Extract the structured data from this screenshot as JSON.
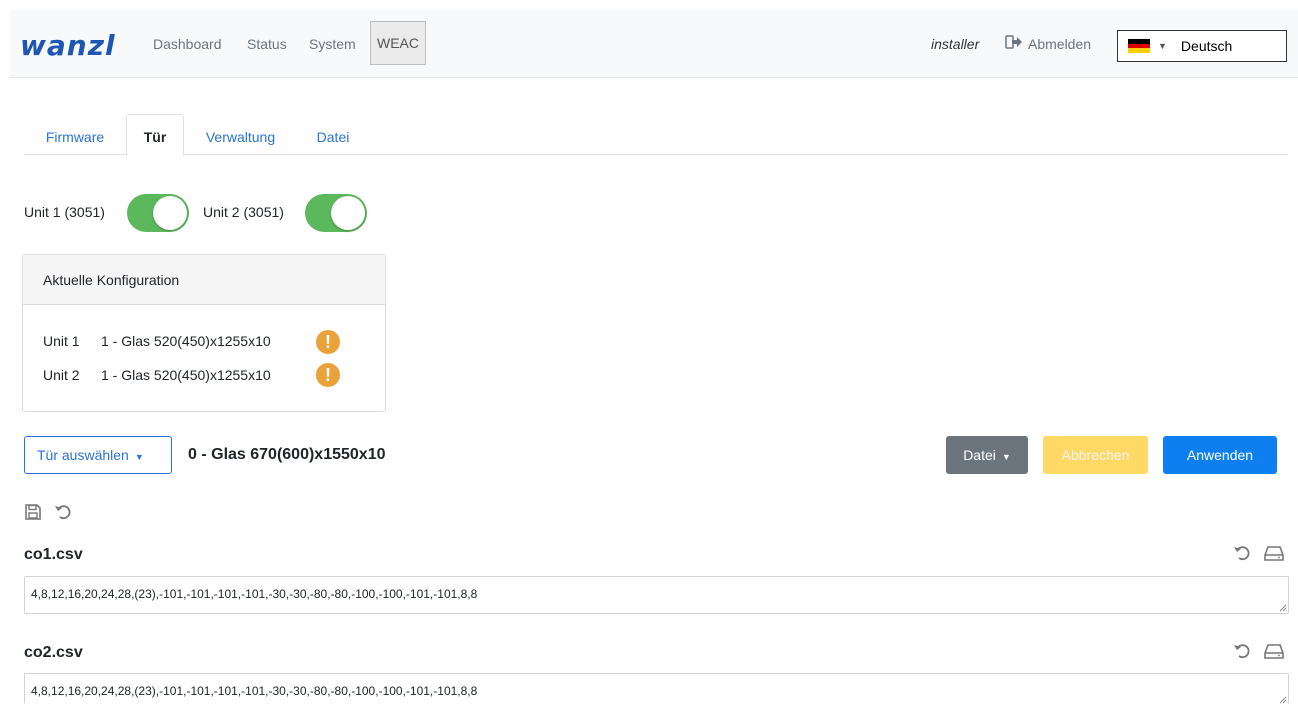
{
  "navbar": {
    "brand": "wanzl",
    "links": [
      "Dashboard",
      "Status",
      "System",
      "WEAC"
    ],
    "user": "installer",
    "logout_label": "Abmelden",
    "language": "Deutsch",
    "icons": {
      "logout": "sign-out-icon",
      "flag": "german-flag-icon"
    }
  },
  "tabs": [
    "Firmware",
    "Tür",
    "Verwaltung",
    "Datei"
  ],
  "units": {
    "unit1_label": "Unit 1 (3051)",
    "unit1_on": true,
    "unit2_label": "Unit 2 (3051)",
    "unit2_on": true
  },
  "config_card": {
    "title": "Aktuelle Konfiguration",
    "rows": [
      {
        "unit": "Unit 1",
        "value": "1 - Glas 520(450)x1255x10",
        "warning": "!"
      },
      {
        "unit": "Unit 2",
        "value": "1 - Glas 520(450)x1255x10",
        "warning": "!"
      }
    ]
  },
  "door": {
    "select_label": "Tür auswählen",
    "selected": "0 - Glas 670(600)x1550x10"
  },
  "actions": {
    "file_label": "Datei",
    "cancel_label": "Abbrechen",
    "apply_label": "Anwenden"
  },
  "files": [
    {
      "name": "co1.csv",
      "content": "4,8,12,16,20,24,28,(23),-101,-101,-101,-101,-30,-30,-80,-80,-100,-100,-101,-101,8,8"
    },
    {
      "name": "co2.csv",
      "content": "4,8,12,16,20,24,28,(23),-101,-101,-101,-101,-30,-30,-80,-80,-100,-100,-101,-101,8,8"
    }
  ],
  "colors": {
    "brand": "#1e56b4",
    "toggle_on": "#5cb85c",
    "warning": "#eaa23a",
    "primary": "#0d7ff0",
    "secondary": "#6c757d",
    "cancel": "#ffd966"
  }
}
